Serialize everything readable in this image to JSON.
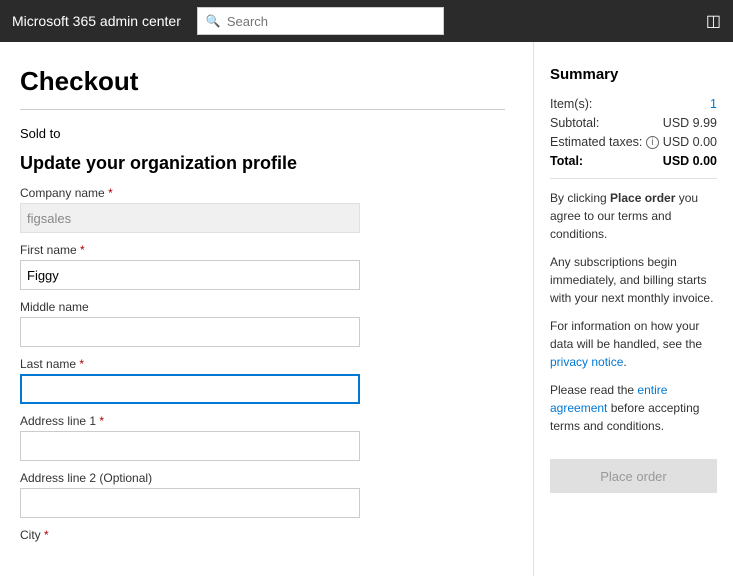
{
  "header": {
    "title": "Microsoft 365 admin center",
    "search_placeholder": "Search",
    "grid_icon": "⊞"
  },
  "page": {
    "title": "Checkout",
    "sold_to_label": "Sold to",
    "section_title": "Update your organization profile"
  },
  "form": {
    "company_name_label": "Company name",
    "company_name_value": "figsales",
    "first_name_label": "First name",
    "first_name_value": "Figgy",
    "middle_name_label": "Middle name",
    "middle_name_value": "",
    "last_name_label": "Last name",
    "last_name_value": "",
    "address1_label": "Address line 1",
    "address1_value": "",
    "address2_label": "Address line 2 (Optional)",
    "address2_value": "",
    "city_label": "City"
  },
  "summary": {
    "title": "Summary",
    "items_label": "Item(s):",
    "items_value": "1",
    "subtotal_label": "Subtotal:",
    "subtotal_value": "USD 9.99",
    "tax_label": "Estimated taxes:",
    "tax_value": "USD 0.00",
    "total_label": "Total:",
    "total_value": "USD 0.00",
    "note1": "By clicking Place order you agree to our terms and conditions.",
    "note2": "Any subscriptions begin immediately, and billing starts with your next monthly invoice.",
    "note3": "For information on how your data will be handled, see the privacy notice.",
    "note4": "Please read the entire agreement before accepting terms and conditions.",
    "place_order_label": "Place order",
    "place_order_link": "Place order",
    "privacy_notice_link": "privacy notice",
    "entire_agreement_link": "entire agreement"
  }
}
